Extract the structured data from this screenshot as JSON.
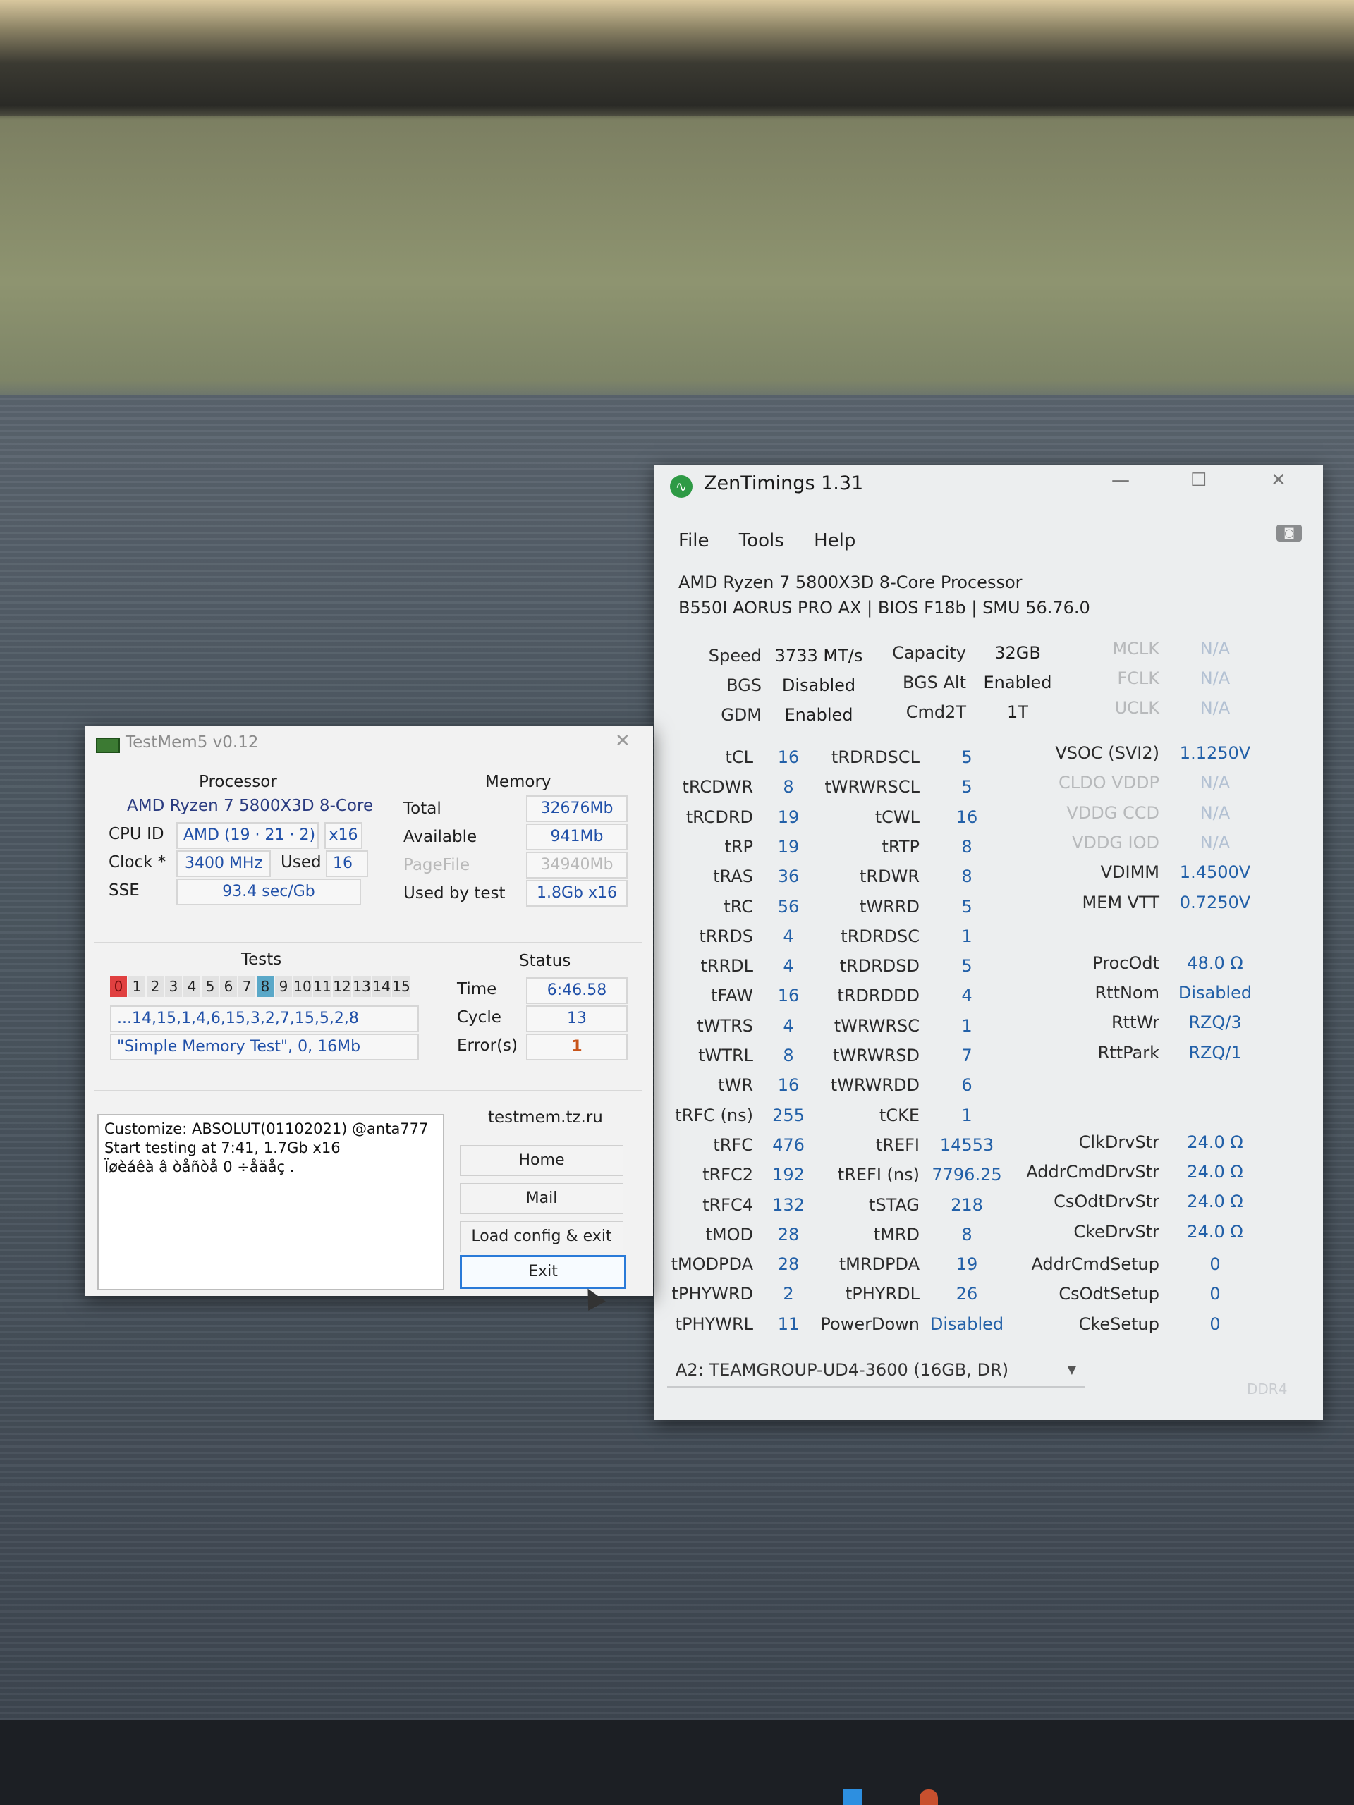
{
  "zentimings": {
    "title": "ZenTimings 1.31",
    "window_controls": {
      "minimize": "—",
      "maximize": "☐",
      "close": "✕"
    },
    "menu": [
      "File",
      "Tools",
      "Help"
    ],
    "cpu": "AMD Ryzen 7 5800X3D 8-Core Processor",
    "board": "B550I AORUS PRO AX | BIOS F18b | SMU 56.76.0",
    "top": [
      {
        "label": "Speed",
        "value": "3733 MT/s"
      },
      {
        "label": "BGS",
        "value": "Disabled"
      },
      {
        "label": "GDM",
        "value": "Enabled"
      },
      {
        "label": "Capacity",
        "value": "32GB"
      },
      {
        "label": "BGS Alt",
        "value": "Enabled"
      },
      {
        "label": "Cmd2T",
        "value": "1T"
      },
      {
        "label": "MCLK",
        "value": "N/A"
      },
      {
        "label": "FCLK",
        "value": "N/A"
      },
      {
        "label": "UCLK",
        "value": "N/A"
      }
    ],
    "col1": [
      {
        "label": "tCL",
        "value": "16"
      },
      {
        "label": "tRCDWR",
        "value": "8"
      },
      {
        "label": "tRCDRD",
        "value": "19"
      },
      {
        "label": "tRP",
        "value": "19"
      },
      {
        "label": "tRAS",
        "value": "36"
      },
      {
        "label": "tRC",
        "value": "56"
      },
      {
        "label": "tRRDS",
        "value": "4"
      },
      {
        "label": "tRRDL",
        "value": "4"
      },
      {
        "label": "tFAW",
        "value": "16"
      },
      {
        "label": "tWTRS",
        "value": "4"
      },
      {
        "label": "tWTRL",
        "value": "8"
      },
      {
        "label": "tWR",
        "value": "16"
      },
      {
        "label": "tRFC (ns)",
        "value": "255"
      },
      {
        "label": "tRFC",
        "value": "476"
      },
      {
        "label": "tRFC2",
        "value": "192"
      },
      {
        "label": "tRFC4",
        "value": "132"
      },
      {
        "label": "tMOD",
        "value": "28"
      },
      {
        "label": "tMODPDA",
        "value": "28"
      },
      {
        "label": "tPHYWRD",
        "value": "2"
      },
      {
        "label": "tPHYWRL",
        "value": "11"
      }
    ],
    "col2": [
      {
        "label": "tRDRDSCL",
        "value": "5"
      },
      {
        "label": "tWRWRSCL",
        "value": "5"
      },
      {
        "label": "tCWL",
        "value": "16"
      },
      {
        "label": "tRTP",
        "value": "8"
      },
      {
        "label": "tRDWR",
        "value": "8"
      },
      {
        "label": "tWRRD",
        "value": "5"
      },
      {
        "label": "tRDRDSC",
        "value": "1"
      },
      {
        "label": "tRDRDSD",
        "value": "5"
      },
      {
        "label": "tRDRDDD",
        "value": "4"
      },
      {
        "label": "tWRWRSC",
        "value": "1"
      },
      {
        "label": "tWRWRSD",
        "value": "7"
      },
      {
        "label": "tWRWRDD",
        "value": "6"
      },
      {
        "label": "tCKE",
        "value": "1"
      },
      {
        "label": "tREFI",
        "value": "14553"
      },
      {
        "label": "tREFI (ns)",
        "value": "7796.25"
      },
      {
        "label": "tSTAG",
        "value": "218"
      },
      {
        "label": "tMRD",
        "value": "8"
      },
      {
        "label": "tMRDPDA",
        "value": "19"
      },
      {
        "label": "tPHYRDL",
        "value": "26"
      },
      {
        "label": "PowerDown",
        "value": "Disabled"
      }
    ],
    "volt": [
      {
        "label": "VSOC (SVI2)",
        "value": "1.1250V"
      },
      {
        "label": "CLDO VDDP",
        "value": "N/A"
      },
      {
        "label": "VDDG CCD",
        "value": "N/A"
      },
      {
        "label": "VDDG IOD",
        "value": "N/A"
      },
      {
        "label": "VDIMM",
        "value": "1.4500V"
      },
      {
        "label": "MEM VTT",
        "value": "0.7250V"
      }
    ],
    "odt": [
      {
        "label": "ProcOdt",
        "value": "48.0 Ω"
      },
      {
        "label": "RttNom",
        "value": "Disabled"
      },
      {
        "label": "RttWr",
        "value": "RZQ/3"
      },
      {
        "label": "RttPark",
        "value": "RZQ/1"
      }
    ],
    "drv": [
      {
        "label": "ClkDrvStr",
        "value": "24.0 Ω"
      },
      {
        "label": "AddrCmdDrvStr",
        "value": "24.0 Ω"
      },
      {
        "label": "CsOdtDrvStr",
        "value": "24.0 Ω"
      },
      {
        "label": "CkeDrvStr",
        "value": "24.0 Ω"
      }
    ],
    "setup": [
      {
        "label": "AddrCmdSetup",
        "value": "0"
      },
      {
        "label": "CsOdtSetup",
        "value": "0"
      },
      {
        "label": "CkeSetup",
        "value": "0"
      }
    ],
    "dimm_select": "A2: TEAMGROUP-UD4-3600 (16GB, DR)",
    "mem_type": "DDR4"
  },
  "testmem": {
    "title": "TestMem5 v0.12",
    "processor_header": "Processor",
    "processor_name": "AMD Ryzen 7 5800X3D 8-Core",
    "cpu_id_label": "CPU ID",
    "cpu_id_value": "AMD  (19 · 21 · 2)",
    "cpu_threads": "x16",
    "clock_label": "Clock *",
    "clock_value": "3400 MHz",
    "used_label": "Used",
    "used_value": "16",
    "sse_label": "SSE",
    "sse_value": "93.4 sec/Gb",
    "memory_header": "Memory",
    "total_label": "Total",
    "total_value": "32676Mb",
    "available_label": "Available",
    "available_value": "941Mb",
    "pagefile_label": "PageFile",
    "pagefile_value": "34940Mb",
    "usedbytest_label": "Used by test",
    "usedbytest_value": "1.8Gb x16",
    "tests_header": "Tests",
    "test_cells": [
      "0",
      "1",
      "2",
      "3",
      "4",
      "5",
      "6",
      "7",
      "8",
      "9",
      "10",
      "11",
      "12",
      "13",
      "14",
      "15"
    ],
    "test_sequence": "...14,15,1,4,6,15,3,2,7,15,5,2,8",
    "test_name": "\"Simple Memory Test\", 0, 16Mb",
    "status_header": "Status",
    "time_label": "Time",
    "time_value": "6:46.58",
    "cycle_label": "Cycle",
    "cycle_value": "13",
    "errors_label": "Error(s)",
    "errors_value": "1",
    "log": [
      "Customize: ABSOLUT(01102021) @anta777",
      "Start testing at 7:41, 1.7Gb x16",
      "Ïøèáêà â òåñòå 0 ÷åäåç ."
    ],
    "site": "testmem.tz.ru",
    "buttons": {
      "home": "Home",
      "mail": "Mail",
      "load": "Load config & exit",
      "exit": "Exit"
    },
    "window_controls": {
      "close": "✕"
    }
  },
  "colors": {
    "value_blue": "#2260a8",
    "error_red": "#e04040",
    "active_test_blue": "#5aa8c8",
    "focus_blue": "#2a7ad8"
  }
}
